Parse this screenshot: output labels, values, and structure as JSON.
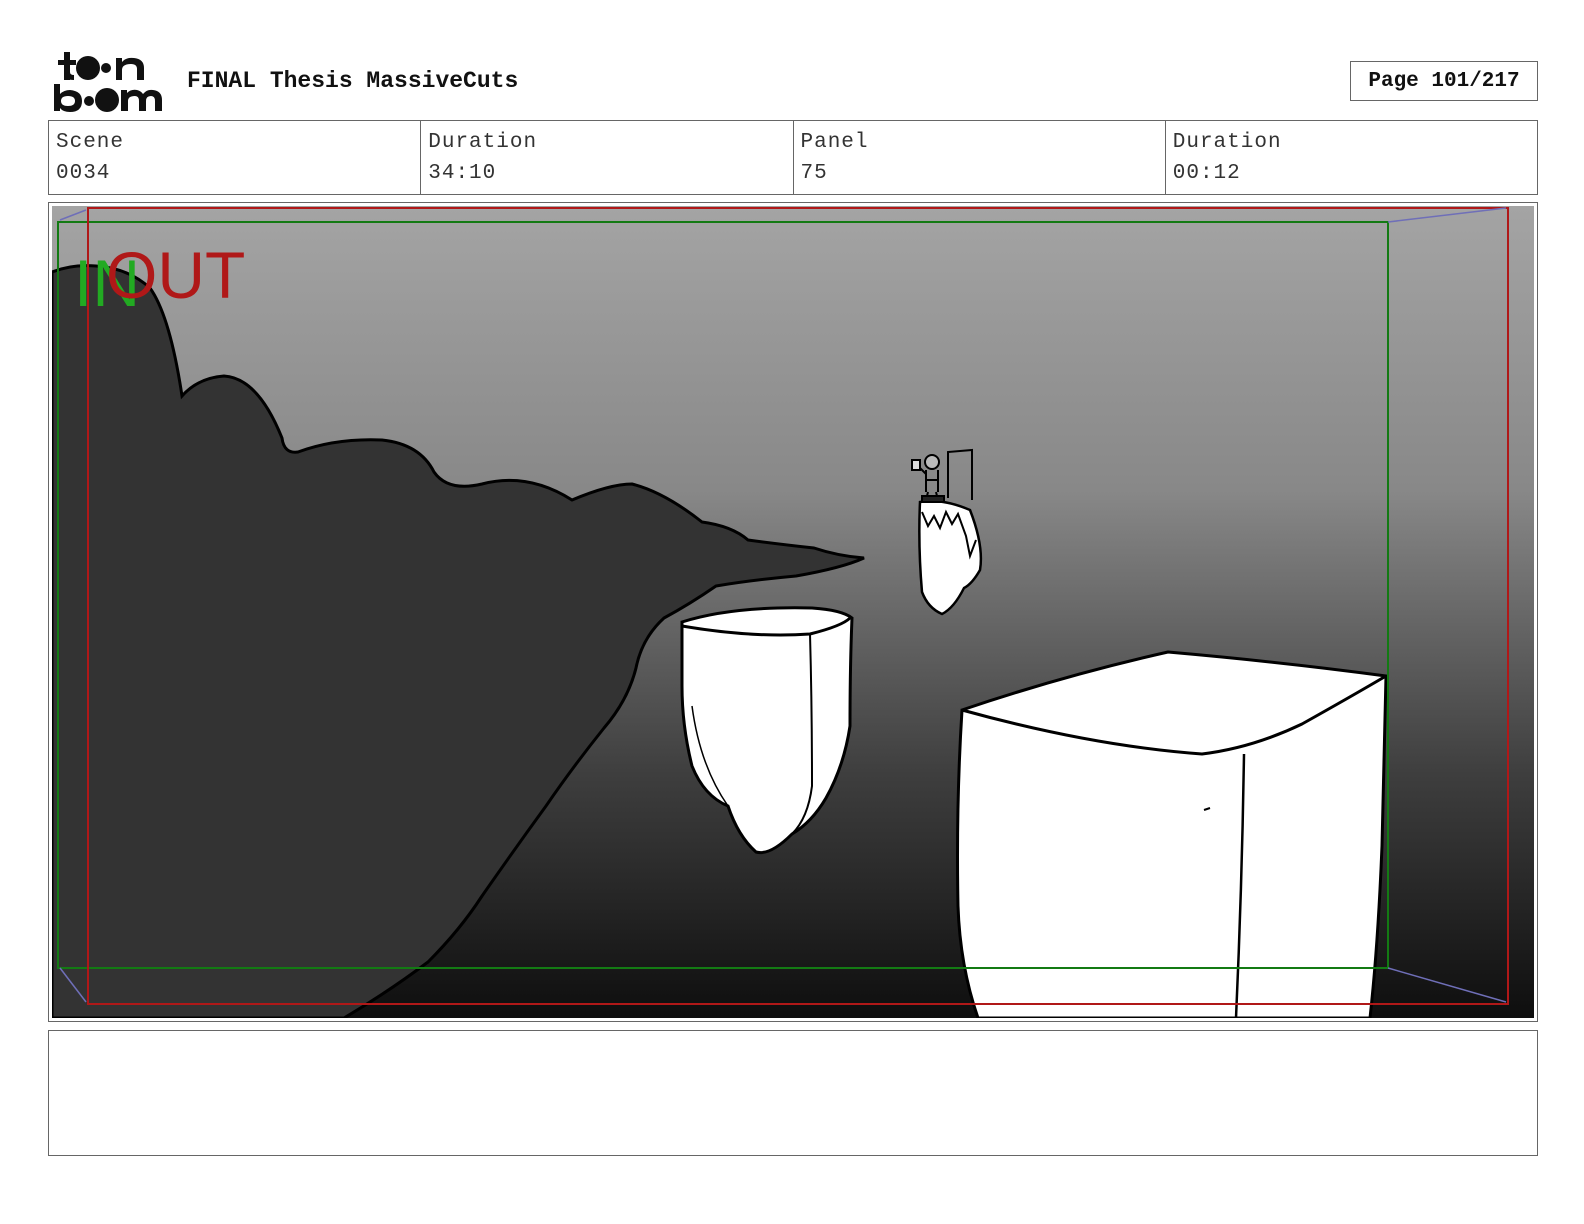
{
  "header": {
    "logo_text": "toonboom",
    "project_title": "FINAL Thesis MassiveCuts",
    "page_label": "Page 101/217"
  },
  "info": {
    "scene_label": "Scene",
    "scene_value": "0034",
    "scene_duration_label": "Duration",
    "scene_duration_value": "34:10",
    "panel_label": "Panel",
    "panel_value": "75",
    "panel_duration_label": "Duration",
    "panel_duration_value": "00:12"
  },
  "panel": {
    "in_marker": "IN",
    "out_marker": "OUT",
    "in_color": "#22aa22",
    "out_color": "#b01818"
  },
  "caption": {
    "text": ""
  }
}
